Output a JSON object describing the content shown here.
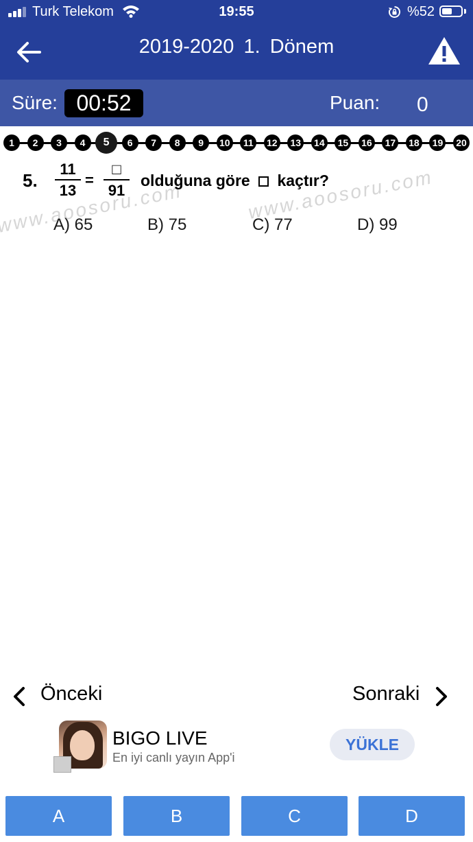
{
  "status_bar": {
    "carrier": "Turk Telekom",
    "time": "19:55",
    "battery_percent": "%52",
    "battery_level": 0.52,
    "signal_bars_filled": 3,
    "icons": [
      "signal-icon",
      "wifi-icon",
      "rotation-lock-icon",
      "battery-icon"
    ]
  },
  "header": {
    "title": "2019-2020  1. Dönem",
    "back_icon": "arrow-left-icon",
    "report_icon": "warning-triangle-icon",
    "background_color": "#253f9a"
  },
  "score_bar": {
    "time_label": "Süre:",
    "time_value": "00:52",
    "score_label": "Puan:",
    "score_value": "0",
    "background_color": "#3e56a5"
  },
  "navigator": {
    "current": 5,
    "questions": [
      "1",
      "2",
      "3",
      "4",
      "5",
      "6",
      "7",
      "8",
      "9",
      "10",
      "11",
      "12",
      "13",
      "14",
      "15",
      "16",
      "17",
      "18",
      "19",
      "20"
    ]
  },
  "question": {
    "number": "5.",
    "fraction_left": {
      "numerator": "11",
      "denominator": "13"
    },
    "equals": "=",
    "fraction_right": {
      "numerator": "□",
      "denominator": "91"
    },
    "text_before_box": "olduğuna göre",
    "text_after_box": "kaçtır?",
    "watermarks": [
      "www.aoosoru.com",
      "www.aoosoru.com"
    ],
    "options": [
      {
        "letter": "A)",
        "value": "65"
      },
      {
        "letter": "B)",
        "value": "75"
      },
      {
        "letter": "C)",
        "value": "77"
      },
      {
        "letter": "D)",
        "value": "99"
      }
    ]
  },
  "pager": {
    "previous_label": "Önceki",
    "next_label": "Sonraki"
  },
  "ad": {
    "title": "BIGO LIVE",
    "subtitle": "En iyi canlı yayın App'i",
    "cta": "YÜKLE"
  },
  "answers": {
    "buttons": [
      "A",
      "B",
      "C",
      "D"
    ],
    "color": "#4a8be0"
  }
}
